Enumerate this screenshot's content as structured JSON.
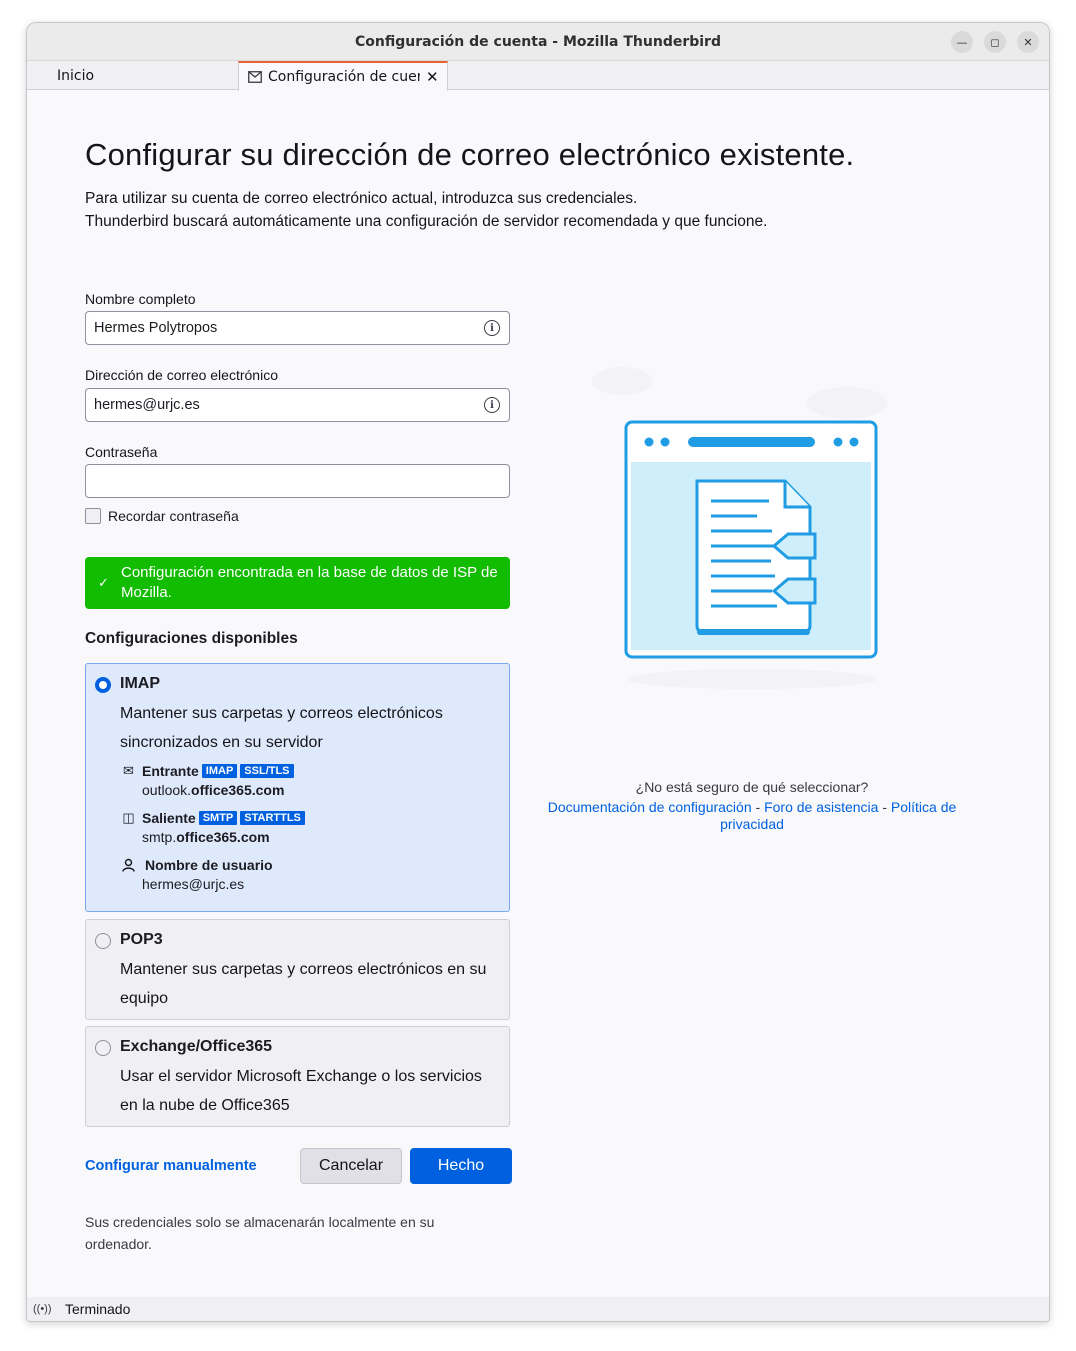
{
  "window": {
    "title": "Configuración de cuenta - Mozilla Thunderbird"
  },
  "tabs": [
    {
      "label": "Inicio"
    },
    {
      "label": "Configuración de cuenta"
    }
  ],
  "page": {
    "heading": "Configurar su dirección de correo electrónico existente.",
    "intro_line1": "Para utilizar su cuenta de correo electrónico actual, introduzca sus credenciales.",
    "intro_line2": "Thunderbird buscará automáticamente una configuración de servidor recomendada y que funcione."
  },
  "form": {
    "name_label": "Nombre completo",
    "name_value": "Hermes Polytropos",
    "email_label": "Dirección de correo electrónico",
    "email_value": "hermes@urjc.es",
    "password_label": "Contraseña",
    "password_value": "",
    "remember_label": "Recordar contraseña",
    "remember_checked": false
  },
  "status_message": "Configuración encontrada en la base de datos de ISP de Mozilla.",
  "configs": {
    "title": "Configuraciones disponibles",
    "imap": {
      "title": "IMAP",
      "description": "Mantener sus carpetas y correos electrónicos sincronizados en su servidor",
      "incoming_label": "Entrante",
      "incoming_badges": [
        "IMAP",
        "SSL/TLS"
      ],
      "incoming_host_prefix": "outlook.",
      "incoming_host_domain": "office365.com",
      "outgoing_label": "Saliente",
      "outgoing_badges": [
        "SMTP",
        "STARTTLS"
      ],
      "outgoing_host_prefix": "smtp.",
      "outgoing_host_domain": "office365.com",
      "username_label": "Nombre de usuario",
      "username_value": "hermes@urjc.es"
    },
    "pop3": {
      "title": "POP3",
      "description": "Mantener sus carpetas y correos electrónicos en su equipo"
    },
    "exchange": {
      "title": "Exchange/Office365",
      "description": "Usar el servidor Microsoft Exchange o los servicios en la nube de Office365"
    }
  },
  "buttons": {
    "manual": "Configurar manualmente",
    "cancel": "Cancelar",
    "done": "Hecho"
  },
  "footnote": "Sus credenciales solo se almacenarán localmente en su ordenador.",
  "help": {
    "question": "¿No está seguro de qué seleccionar?",
    "link_docs": "Documentación de configuración",
    "link_forum": "Foro de asistencia",
    "link_privacy": "Política de privacidad",
    "separator": " - "
  },
  "statusbar": {
    "text": "Terminado",
    "icon": "connection-icon"
  },
  "colors": {
    "accent": "#0061e0",
    "success": "#12bc00",
    "tab_highlight": "#e66432"
  }
}
